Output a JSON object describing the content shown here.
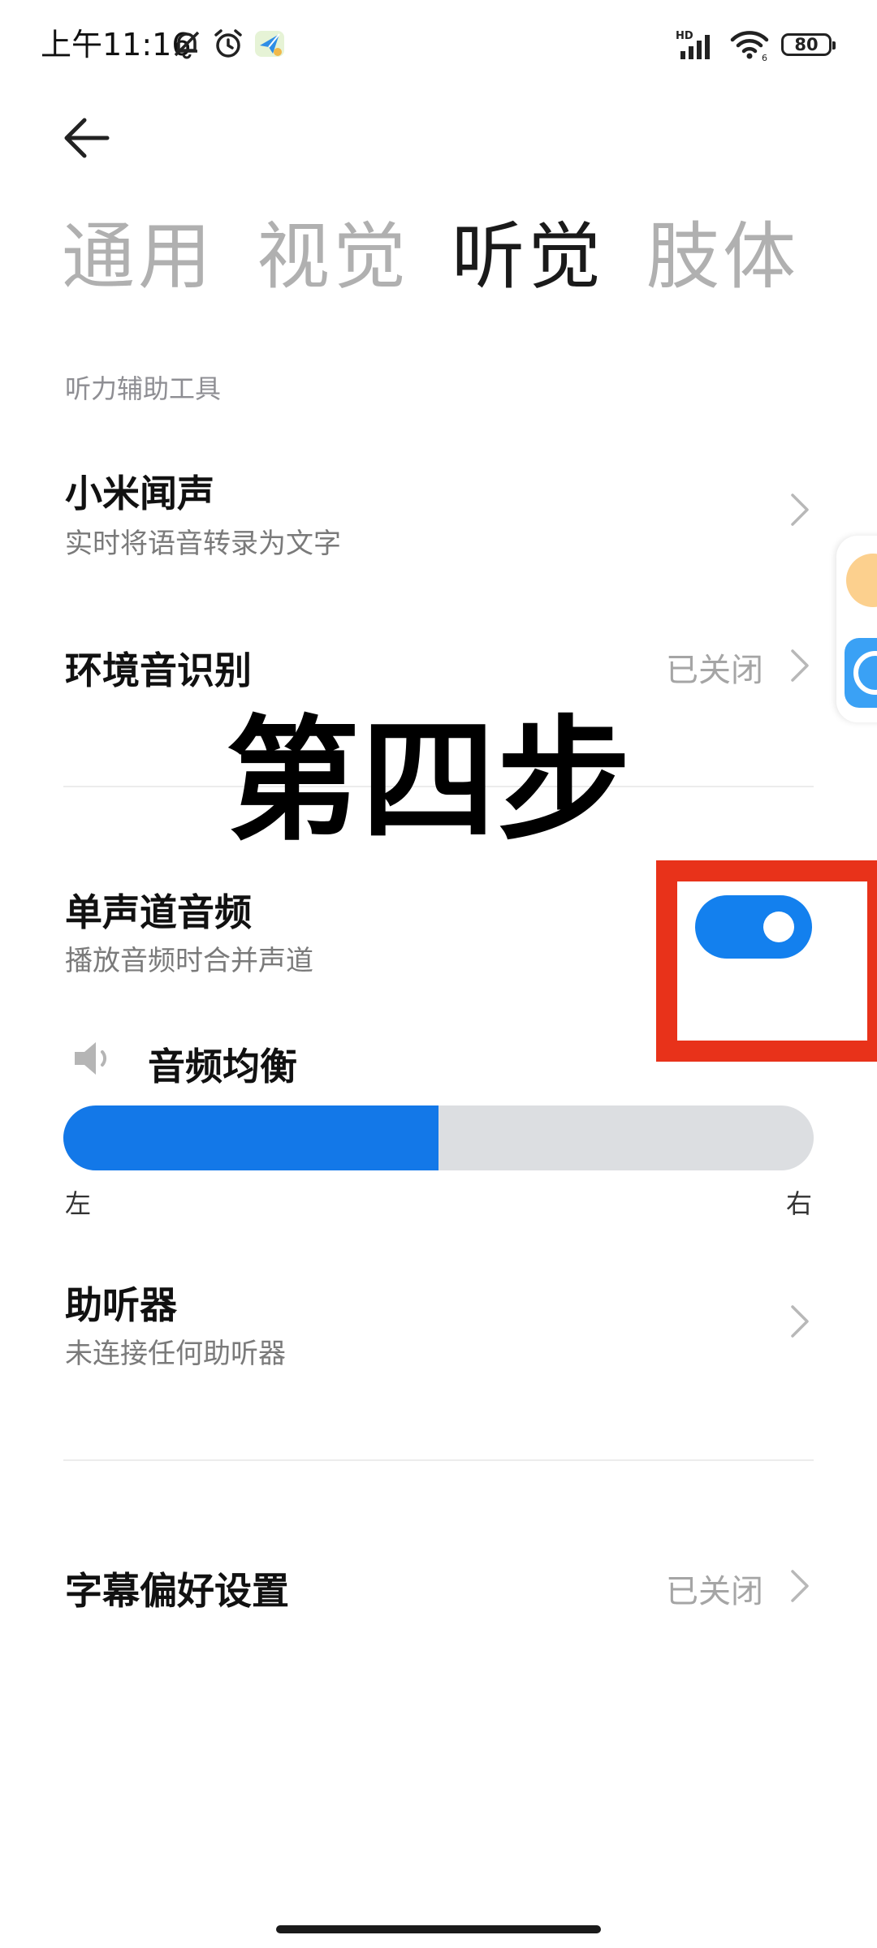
{
  "status_bar": {
    "time": "上午11:16",
    "battery": "80",
    "network_badge": "HD",
    "icons": [
      "mute-bell-icon",
      "alarm-icon",
      "app-notification-icon",
      "signal-icon",
      "wifi-icon",
      "battery-icon"
    ]
  },
  "tabs": [
    {
      "label": "通用",
      "active": false
    },
    {
      "label": "视觉",
      "active": false
    },
    {
      "label": "听觉",
      "active": true
    },
    {
      "label": "肢体",
      "active": false
    }
  ],
  "section_title": "听力辅助工具",
  "rows": {
    "xiaomi_voice": {
      "title": "小米闻声",
      "subtitle": "实时将语音转录为文字"
    },
    "ambient_sound": {
      "title": "环境音识别",
      "value": "已关闭"
    },
    "mono_audio": {
      "title": "单声道音频",
      "subtitle": "播放音频时合并声道",
      "enabled": true
    },
    "audio_balance": {
      "title": "音频均衡",
      "left_label": "左",
      "right_label": "右",
      "balance": 0.5
    },
    "hearing_aid": {
      "title": "助听器",
      "subtitle": "未连接任何助听器"
    },
    "caption_prefs": {
      "title": "字幕偏好设置",
      "value": "已关闭"
    }
  },
  "overlay_text": "第四步",
  "colors": {
    "accent": "#1380ee",
    "highlight": "#e8321a",
    "track": "#dcdee1"
  }
}
